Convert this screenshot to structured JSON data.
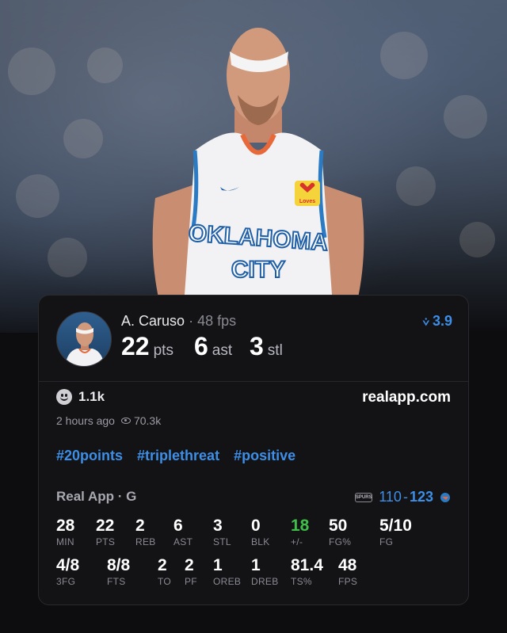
{
  "player": {
    "name": "A. Caruso",
    "dot": "·",
    "fps_label": "48 fps",
    "big_stats": [
      {
        "value": "22",
        "unit": "pts"
      },
      {
        "value": "6",
        "unit": "ast"
      },
      {
        "value": "3",
        "unit": "stl"
      }
    ],
    "rating": "3.9",
    "jersey_text_line1": "OKLAHOMA",
    "jersey_text_line2": "CITY",
    "patch": "Loves"
  },
  "social": {
    "reactions": "1.1k",
    "site": "realapp.com",
    "time_ago": "2 hours ago",
    "views": "70.3k"
  },
  "tags": [
    "#20points",
    "#triplethreat",
    "#positive"
  ],
  "game": {
    "label": "Real App · G",
    "away_logo": "SPURS",
    "away_score": "110",
    "separator": "-",
    "home_score": "123"
  },
  "stats_row1": [
    {
      "value": "28",
      "label": "MIN"
    },
    {
      "value": "22",
      "label": "PTS"
    },
    {
      "value": "2",
      "label": "REB"
    },
    {
      "value": "6",
      "label": "AST"
    },
    {
      "value": "3",
      "label": "STL"
    },
    {
      "value": "0",
      "label": "BLK"
    },
    {
      "value": "18",
      "label": "+/-",
      "color": "#3fbf4a"
    },
    {
      "value": "50",
      "label": "FG%"
    },
    {
      "value": "5/10",
      "label": "FG"
    }
  ],
  "stats_row2": [
    {
      "value": "4/8",
      "label": "3FG"
    },
    {
      "value": "8/8",
      "label": "FTS"
    },
    {
      "value": "2",
      "label": "TO"
    },
    {
      "value": "2",
      "label": "PF"
    },
    {
      "value": "1",
      "label": "OREB"
    },
    {
      "value": "1",
      "label": "DREB"
    },
    {
      "value": "81.4",
      "label": "TS%"
    },
    {
      "value": "48",
      "label": "FPS"
    }
  ],
  "colors": {
    "accent": "#3d8ee6",
    "positive": "#3fbf4a",
    "card": "#131316"
  }
}
